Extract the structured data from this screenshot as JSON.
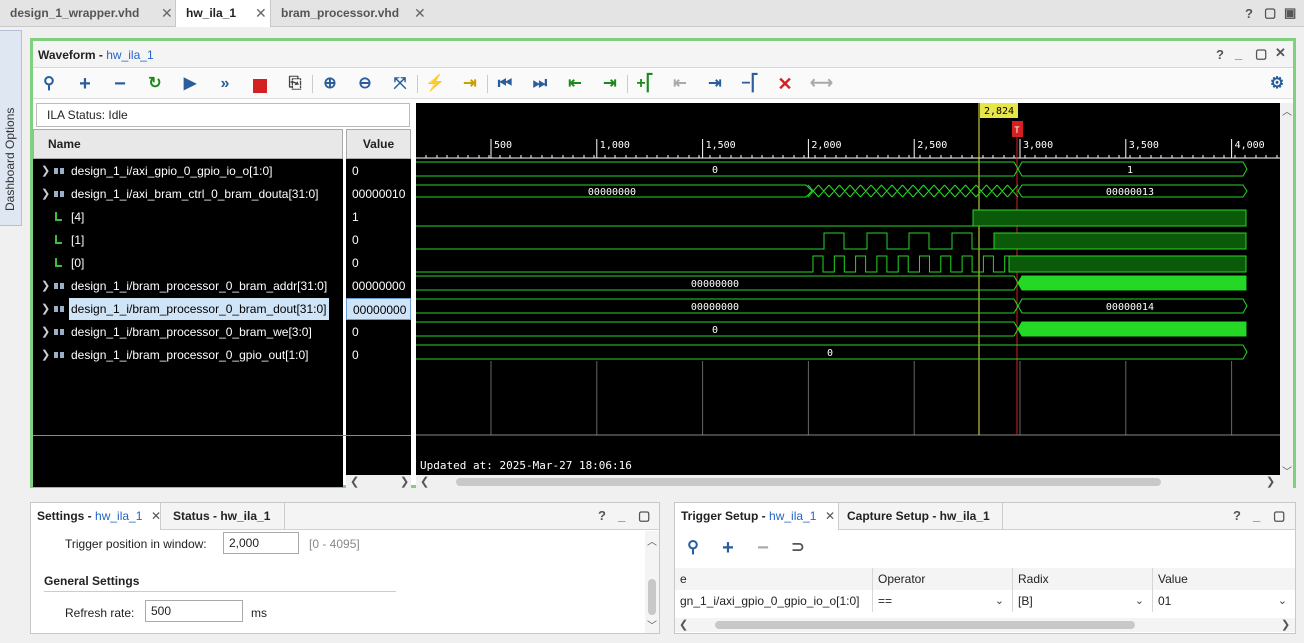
{
  "file_tabs": [
    {
      "label": "design_1_wrapper.vhd"
    },
    {
      "label": "hw_ila_1"
    },
    {
      "label": "bram_processor.vhd"
    }
  ],
  "sidebar_tab": "Dashboard Options",
  "waveform": {
    "title": "Waveform",
    "title_link": "hw_ila_1",
    "ila_status": "ILA Status:  Idle",
    "name_header": "Name",
    "value_header": "Value",
    "signals": [
      {
        "name": "design_1_i/axi_gpio_0_gpio_io_o[1:0]",
        "value": "0",
        "type": "bus"
      },
      {
        "name": "design_1_i/axi_bram_ctrl_0_bram_douta[31:0]",
        "value": "00000010",
        "type": "bus"
      },
      {
        "name": "[4]",
        "value": "1",
        "type": "bit"
      },
      {
        "name": "[1]",
        "value": "0",
        "type": "bit"
      },
      {
        "name": "[0]",
        "value": "0",
        "type": "bit"
      },
      {
        "name": "design_1_i/bram_processor_0_bram_addr[31:0]",
        "value": "00000000",
        "type": "bus"
      },
      {
        "name": "design_1_i/bram_processor_0_bram_dout[31:0]",
        "value": "00000000",
        "type": "bus",
        "selected": true
      },
      {
        "name": "design_1_i/bram_processor_0_bram_we[3:0]",
        "value": "0",
        "type": "bus"
      },
      {
        "name": "design_1_i/bram_processor_0_gpio_out[1:0]",
        "value": "0",
        "type": "bus"
      }
    ],
    "time_ticks": [
      "500",
      "1,000",
      "1,500",
      "2,000",
      "2,500",
      "3,000",
      "3,500",
      "4,000"
    ],
    "cursor_label": "2,824",
    "trigger_marker": "T",
    "bus_labels": {
      "gpio_io_before": "0",
      "gpio_io_after": "1",
      "douta_before": "00000000",
      "douta_after": "00000013",
      "addr_before": "00000000",
      "dout_before": "00000000",
      "dout_after": "00000014",
      "we_before": "0",
      "gpio_out": "0"
    },
    "updated_at": "Updated at: 2025-Mar-27 18:06:16"
  },
  "settings_panel": {
    "tabs": [
      {
        "label": "Settings - ",
        "link": "hw_ila_1"
      },
      {
        "label": "Status - hw_ila_1"
      }
    ],
    "trigger_pos_label": "Trigger position in window:",
    "trigger_pos_value": "2,000",
    "trigger_pos_range": "[0 - 4095]",
    "general_heading": "General Settings",
    "refresh_label": "Refresh rate:",
    "refresh_value": "500",
    "refresh_unit": "ms"
  },
  "trigger_panel": {
    "tabs": [
      {
        "label": "Trigger Setup - ",
        "link": "hw_ila_1"
      },
      {
        "label": "Capture Setup - hw_ila_1"
      }
    ],
    "columns": [
      "e",
      "Operator",
      "Radix",
      "Value"
    ],
    "row": {
      "name": "gn_1_i/axi_gpio_0_gpio_io_o[1:0]",
      "operator": "==",
      "radix": "[B]",
      "value": "01"
    }
  },
  "colors": {
    "wave_green": "#26d826",
    "wave_dark_green": "#0a5a0a",
    "cursor_yellow": "#e6e64a",
    "trigger_red": "#d42020",
    "frame_green": "#80d080",
    "link_blue": "#2366c6"
  }
}
